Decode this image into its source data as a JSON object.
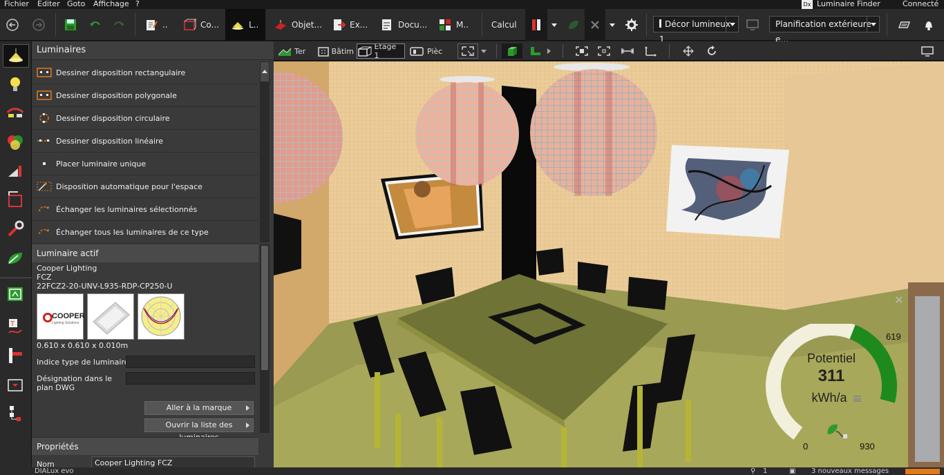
{
  "menu": {
    "items": [
      "Fichier",
      "Editer",
      "Goto",
      "Affichage",
      "?"
    ],
    "luminaire_finder": "Luminaire Finder",
    "luminaire_finder_logo": "Dx",
    "connecte": "Connecté"
  },
  "toolbar": {
    "tabs": [
      {
        "label": "..",
        "icon": "edit-icon"
      },
      {
        "label": "Co...",
        "icon": "construction-icon"
      },
      {
        "label": "L..",
        "icon": "luminaire-icon"
      },
      {
        "label": "Objet...",
        "icon": "objects-icon"
      },
      {
        "label": "Ex...",
        "icon": "export-icon"
      },
      {
        "label": "Docu...",
        "icon": "documentation-icon"
      },
      {
        "label": "M..",
        "icon": "modules-icon"
      }
    ],
    "calcul": "Calcul",
    "scene_select": "Décor lumineux 1",
    "planning_select": "Planification extérieure e..."
  },
  "panel": {
    "title": "Luminaires",
    "actions": [
      {
        "label": "Dessiner disposition rectangulaire",
        "icon": "rectangular-layout-icon"
      },
      {
        "label": "Dessiner disposition polygonale",
        "icon": "polygonal-layout-icon"
      },
      {
        "label": "Dessiner disposition circulaire",
        "icon": "circular-layout-icon"
      },
      {
        "label": "Dessiner disposition linéaire",
        "icon": "linear-layout-icon"
      },
      {
        "label": "Placer luminaire unique",
        "icon": "single-luminaire-icon"
      },
      {
        "label": "Disposition automatique pour l'espace",
        "icon": "auto-layout-icon"
      },
      {
        "label": "Échanger les luminaires sélectionnés",
        "icon": "swap-selected-icon"
      },
      {
        "label": "Échanger tous les luminaires de ce type",
        "icon": "swap-all-icon"
      }
    ],
    "active_title": "Luminaire actif",
    "manufacturer": "Cooper Lighting",
    "family": "FCZ",
    "article": "22FCZ2-20-UNV-L935-RDP-CP250-U",
    "brand_logo_text": "COOPER",
    "brand_logo_sub": "Lighting Solutions",
    "dimensions": "0.610 x 0.610 x 0.010m",
    "field1_label": "Indice type de luminaire",
    "field1_value": "",
    "field2_label": "Désignation dans le plan DWG",
    "field2_value": "",
    "btn_brand": "Aller à la marque",
    "btn_list": "Ouvrir la liste des luminaires",
    "props_title": "Propriétés",
    "nom_label": "Nom",
    "nom_value": "Cooper Lighting FCZ"
  },
  "view_toolbar": {
    "terrain": "Ter",
    "batiment": "Bâtim",
    "etage": "Étage 1",
    "piece": "Pièc"
  },
  "gauge": {
    "label": "Potentiel",
    "value": "311",
    "unit": "kWh/a",
    "min": "0",
    "max": "930",
    "marker": "619",
    "value_num": 311,
    "min_num": 0,
    "max_num": 930,
    "marker_num": 619,
    "color_low": "#1e8a1e",
    "color_track": "#f2efdc"
  },
  "status": {
    "left": "DIALux evo",
    "count": "1",
    "messages": "3 nouveaux messages"
  },
  "colors": {
    "accent_orange": "#e07a1a",
    "green": "#2e9a2e",
    "panel": "#3a3a3a",
    "header": "#4a4a4a"
  }
}
